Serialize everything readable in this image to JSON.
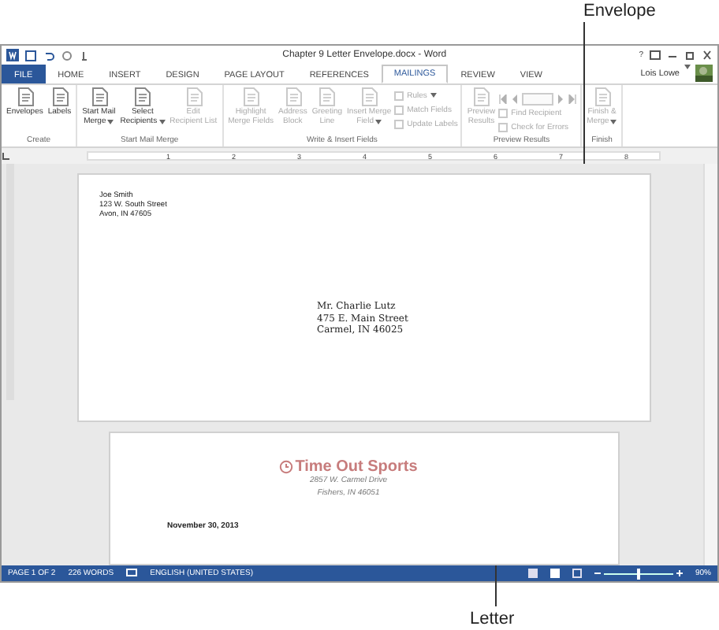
{
  "top_callout": "Envelope",
  "bottom_callout": "Letter",
  "window": {
    "title": "Chapter 9 Letter Envelope.docx - Word",
    "help": "?",
    "user": "Lois Lowe"
  },
  "tabs": [
    {
      "label": "FILE",
      "kind": "file",
      "selected": false
    },
    {
      "label": "HOME",
      "kind": "tab",
      "selected": false
    },
    {
      "label": "INSERT",
      "kind": "tab",
      "selected": false
    },
    {
      "label": "DESIGN",
      "kind": "tab",
      "selected": false
    },
    {
      "label": "PAGE LAYOUT",
      "kind": "tab",
      "selected": false
    },
    {
      "label": "REFERENCES",
      "kind": "tab",
      "selected": false
    },
    {
      "label": "MAILINGS",
      "kind": "tab",
      "selected": true
    },
    {
      "label": "REVIEW",
      "kind": "tab",
      "selected": false
    },
    {
      "label": "VIEW",
      "kind": "tab",
      "selected": false
    }
  ],
  "ribbon": [
    {
      "name": "Create",
      "items": [
        {
          "kind": "large",
          "lines": [
            "Envelopes"
          ],
          "dropdown": false,
          "disabled": false
        },
        {
          "kind": "large",
          "lines": [
            "Labels"
          ],
          "dropdown": false,
          "disabled": false
        }
      ]
    },
    {
      "name": "Start Mail Merge",
      "items": [
        {
          "kind": "large",
          "lines": [
            "Start Mail",
            "Merge"
          ],
          "dropdown": true,
          "disabled": false
        },
        {
          "kind": "large",
          "lines": [
            "Select",
            "Recipients"
          ],
          "dropdown": true,
          "disabled": false
        },
        {
          "kind": "large",
          "lines": [
            "Edit",
            "Recipient List"
          ],
          "dropdown": false,
          "disabled": true
        }
      ]
    },
    {
      "name": "Write & Insert Fields",
      "items": [
        {
          "kind": "large",
          "lines": [
            "Highlight",
            "Merge Fields"
          ],
          "dropdown": false,
          "disabled": true
        },
        {
          "kind": "large",
          "lines": [
            "Address",
            "Block"
          ],
          "dropdown": false,
          "disabled": true
        },
        {
          "kind": "large",
          "lines": [
            "Greeting",
            "Line"
          ],
          "dropdown": false,
          "disabled": true
        },
        {
          "kind": "large",
          "lines": [
            "Insert Merge",
            "Field"
          ],
          "dropdown": true,
          "disabled": true
        },
        {
          "kind": "small",
          "buttons": [
            {
              "label": "Rules",
              "dropdown": true
            },
            {
              "label": "Match Fields",
              "dropdown": false
            },
            {
              "label": "Update Labels",
              "dropdown": false
            }
          ],
          "disabled": true
        }
      ]
    },
    {
      "name": "Preview Results",
      "items": [
        {
          "kind": "large",
          "lines": [
            "Preview",
            "Results"
          ],
          "dropdown": false,
          "disabled": true
        },
        {
          "kind": "nav",
          "buttons": [
            {
              "label": "Find Recipient",
              "dropdown": false
            },
            {
              "label": "Check for Errors",
              "dropdown": false
            }
          ],
          "disabled": true
        }
      ]
    },
    {
      "name": "Finish",
      "items": [
        {
          "kind": "large",
          "lines": [
            "Finish &",
            "Merge"
          ],
          "dropdown": true,
          "disabled": true
        }
      ]
    }
  ],
  "ruler": [
    "1",
    "2",
    "3",
    "4",
    "5",
    "6",
    "7",
    "8"
  ],
  "envelope": {
    "return_address": [
      "Joe Smith",
      "123 W. South Street",
      "Avon, IN 47605"
    ],
    "delivery_address": [
      "Mr. Charlie Lutz",
      "475 E. Main Street",
      "Carmel, IN 46025"
    ]
  },
  "letter": {
    "company": "Time Out Sports",
    "address": [
      "2857 W. Carmel Drive",
      "Fishers, IN 46051"
    ],
    "date": "November 30, 2013"
  },
  "status_bar": {
    "page": "PAGE 1 OF 2",
    "words": "226 WORDS",
    "language": "ENGLISH (UNITED STATES)",
    "zoom": "90%",
    "level": 0.5
  }
}
